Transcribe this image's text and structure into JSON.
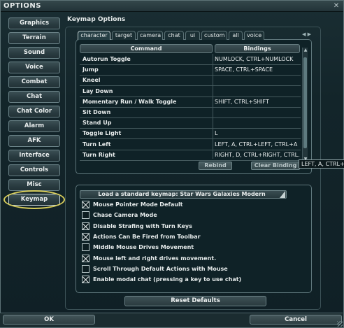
{
  "window": {
    "title": "OPTIONS",
    "close_glyph": "✕"
  },
  "nav": [
    {
      "label": "Graphics"
    },
    {
      "label": "Terrain"
    },
    {
      "label": "Sound"
    },
    {
      "label": "Voice"
    },
    {
      "label": "Combat"
    },
    {
      "label": "Chat"
    },
    {
      "label": "Chat Color"
    },
    {
      "label": "Alarm"
    },
    {
      "label": "AFK"
    },
    {
      "label": "Interface"
    },
    {
      "label": "Controls"
    },
    {
      "label": "Misc"
    },
    {
      "label": "Keymap",
      "active": true
    }
  ],
  "section_title": "Keymap Options",
  "tabs": [
    "character",
    "target",
    "camera",
    "chat",
    "ui",
    "custom",
    "all",
    "voice"
  ],
  "active_tab": "character",
  "tab_arrows": "◀ ▶",
  "table": {
    "headers": {
      "command": "Command",
      "bindings": "Bindings"
    },
    "rows": [
      {
        "command": "Autorun Toggle",
        "binding": "NUMLOCK, CTRL+NUMLOCK"
      },
      {
        "command": "Jump",
        "binding": "SPACE, CTRL+SPACE"
      },
      {
        "command": "Kneel",
        "binding": ""
      },
      {
        "command": "Lay Down",
        "binding": ""
      },
      {
        "command": "Momentary Run / Walk Toggle",
        "binding": "SHIFT, CTRL+SHIFT"
      },
      {
        "command": "Sit Down",
        "binding": ""
      },
      {
        "command": "Stand Up",
        "binding": ""
      },
      {
        "command": "Toggle Light",
        "binding": "L"
      },
      {
        "command": "Turn Left",
        "binding": "LEFT, A, CTRL+LEFT, CTRL+A"
      },
      {
        "command": "Turn Right",
        "binding": "RIGHT, D, CTRL+RIGHT, CTRL..."
      }
    ],
    "rebind_label": "Rebind",
    "clear_label": "Clear Binding",
    "tooltip": "LEFT, A, CTRL+LEFT, CTRL+A"
  },
  "keymap": {
    "load_label": "Load a standard keymap: Star Wars Galaxies Modern"
  },
  "options": [
    {
      "label": "Mouse Pointer Mode Default",
      "checked": true
    },
    {
      "label": "Chase Camera Mode",
      "checked": false
    },
    {
      "label": "Disable Strafing with Turn Keys",
      "checked": true
    },
    {
      "label": "Actions Can Be Fired from Toolbar",
      "checked": true
    },
    {
      "label": "Middle Mouse Drives Movement",
      "checked": false
    },
    {
      "label": "Mouse left and right drives movement.",
      "checked": true
    },
    {
      "label": "Scroll Through Default Actions with Mouse",
      "checked": false
    },
    {
      "label": "Enable modal chat (pressing a key to use chat)",
      "checked": true
    }
  ],
  "reset_label": "Reset Defaults",
  "ok_label": "OK",
  "cancel_label": "Cancel"
}
